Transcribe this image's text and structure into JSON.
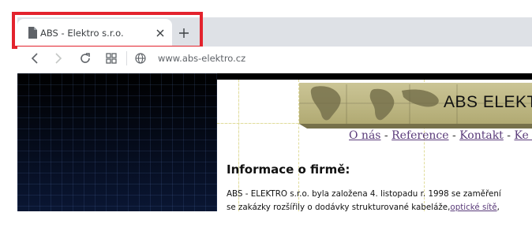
{
  "browser": {
    "tab": {
      "title": "ABS - Elektro s.r.o.",
      "icon": "document-icon"
    },
    "url": "www.abs-elektro.cz",
    "highlight_color": "#e3232d"
  },
  "page": {
    "banner_title": "ABS ELEKTRO",
    "nav": [
      {
        "label": "O nás"
      },
      {
        "label": "Reference"
      },
      {
        "label": "Kontakt"
      },
      {
        "label": "Ke st"
      }
    ],
    "nav_separator": " - ",
    "heading": "Informace o firmě:",
    "paragraph": {
      "line1": "ABS - ELEKTRO s.r.o. byla založena 4. listopadu r. 1998 se zaměření",
      "line2_text": "se zakázky rozšířily o dodávky strukturované kabeláže,",
      "line2_link": "optické sítě",
      "line2_tail": ","
    },
    "link_color": "#5a3b7a"
  }
}
